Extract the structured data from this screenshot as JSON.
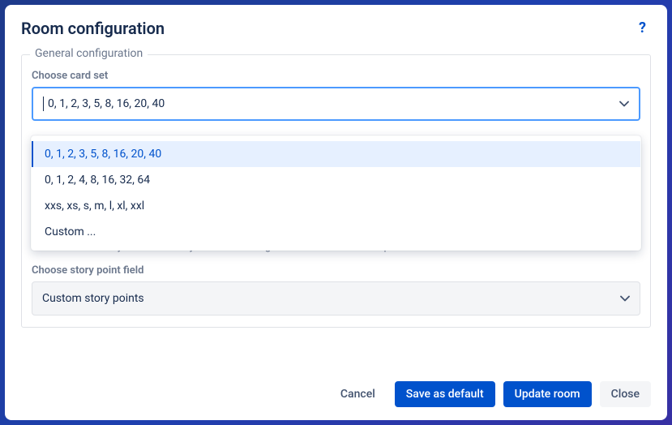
{
  "modal": {
    "title": "Room configuration",
    "help_label": "?"
  },
  "fieldset": {
    "legend": "General configuration"
  },
  "card_set": {
    "label": "Choose card set",
    "value": "0, 1, 2, 3, 5, 8, 16, 20, 40",
    "options": [
      "0, 1, 2, 3, 5, 8, 16, 20, 40",
      "0, 1, 2, 4, 8, 16, 32, 64",
      "xxs, xs, s, m, l, xl, xxl",
      "Custom ..."
    ],
    "selected_index": 0
  },
  "public_help": "If checked then anyone can modify the room configuration or take ownership of the room",
  "story_point": {
    "label": "Choose story point field",
    "value": "Custom story points"
  },
  "footer": {
    "cancel": "Cancel",
    "save_default": "Save as default",
    "update": "Update room",
    "close": "Close"
  }
}
